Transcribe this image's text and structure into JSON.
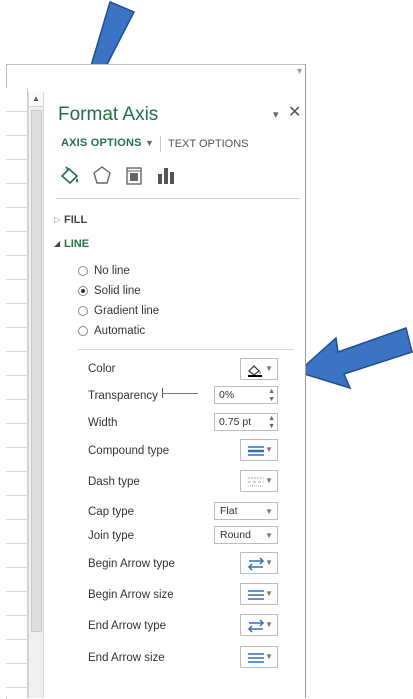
{
  "pane": {
    "title": "Format Axis",
    "pin_glyph": "▾",
    "close_glyph": "✕",
    "tabs": {
      "axis_options": "AXIS OPTIONS",
      "text_options": "TEXT OPTIONS"
    },
    "categories": [
      "fill-line-icon",
      "effects-icon",
      "size-properties-icon",
      "axis-options-icon"
    ]
  },
  "sections": {
    "fill": "FILL",
    "line": "LINE"
  },
  "line_options": {
    "no_line": "No line",
    "solid_line": "Solid line",
    "gradient_line": "Gradient line",
    "automatic": "Automatic",
    "selected": "solid_line"
  },
  "props": {
    "color": "Color",
    "transparency": "Transparency",
    "transparency_value": "0%",
    "width": "Width",
    "width_value": "0.75 pt",
    "compound_type": "Compound type",
    "dash_type": "Dash type",
    "cap_type": "Cap type",
    "cap_value": "Flat",
    "join_type": "Join type",
    "join_value": "Round",
    "begin_arrow_type": "Begin Arrow type",
    "begin_arrow_size": "Begin Arrow size",
    "end_arrow_type": "End Arrow type",
    "end_arrow_size": "End Arrow size"
  },
  "colors": {
    "accent": "#217346",
    "annotation_arrow": "#3c74c4"
  }
}
